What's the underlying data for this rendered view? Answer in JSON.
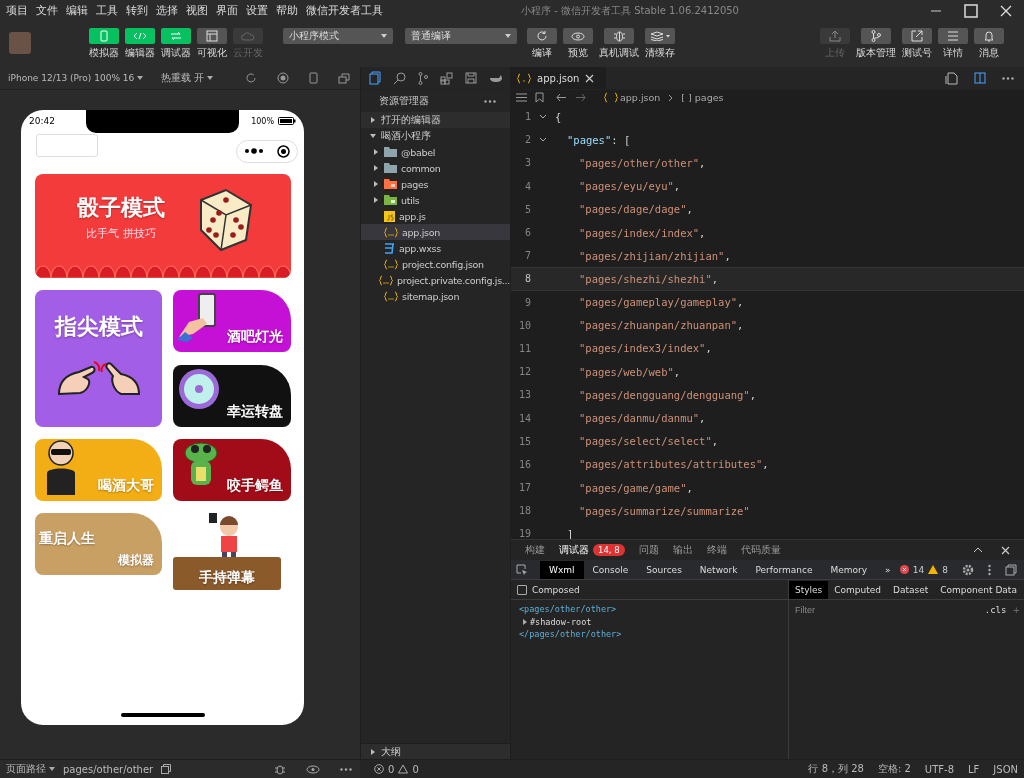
{
  "menu": [
    "项目",
    "文件",
    "编辑",
    "工具",
    "转到",
    "选择",
    "视图",
    "界面",
    "设置",
    "帮助",
    "微信开发者工具"
  ],
  "window": {
    "title": "小程序 - 微信开发者工具 Stable 1.06.2412050"
  },
  "view_toggles": [
    {
      "label": "模拟器",
      "selected": true,
      "disabled": false
    },
    {
      "label": "编辑器",
      "selected": true,
      "disabled": false
    },
    {
      "label": "调试器",
      "selected": true,
      "disabled": false
    },
    {
      "label": "可视化",
      "selected": false,
      "disabled": false
    },
    {
      "label": "云开发",
      "selected": false,
      "disabled": true
    }
  ],
  "mode_select": "小程序模式",
  "compile_select": "普通编译",
  "actions": [
    "编译",
    "预览",
    "真机调试",
    "清缓存"
  ],
  "right_actions": [
    {
      "label": "上传",
      "disabled": true
    },
    {
      "label": "版本管理",
      "disabled": false
    },
    {
      "label": "测试号",
      "disabled": false
    },
    {
      "label": "详情",
      "disabled": false
    },
    {
      "label": "消息",
      "disabled": false
    }
  ],
  "device_select": "iPhone 12/13 (Pro) 100% 16",
  "hot_reload": "热重载 开",
  "phone": {
    "time": "20:42",
    "battery": "100%",
    "cards": [
      {
        "kind": "banner",
        "title": "骰子模式",
        "subtitle": "比手气 拼技巧",
        "color": "#f43b3b"
      },
      {
        "kind": "tall",
        "title": "指尖模式",
        "color": "#a25ee6"
      },
      {
        "kind": "small",
        "title": "酒吧灯光",
        "color": "#c511d6"
      },
      {
        "kind": "small",
        "title": "幸运转盘",
        "color": "#111111"
      },
      {
        "kind": "small",
        "title": "喝酒大哥",
        "color": "#f2ae14"
      },
      {
        "kind": "small",
        "title": "咬手鳄鱼",
        "color": "#a10c18"
      },
      {
        "kind": "small",
        "title": "重启人生",
        "subtitle": "模拟器",
        "color": "#c9a064"
      },
      {
        "kind": "board",
        "title": "手持弹幕",
        "color": "#8a5a2b"
      }
    ]
  },
  "explorer": {
    "title": "资源管理器",
    "sections": [
      {
        "label": "打开的编辑器",
        "expanded": false
      },
      {
        "label": "喝酒小程序",
        "expanded": true,
        "children": [
          {
            "name": "@babel",
            "kind": "folder",
            "expanded": false,
            "selected": false
          },
          {
            "name": "common",
            "kind": "folder",
            "expanded": false,
            "selected": false
          },
          {
            "name": "pages",
            "kind": "pages",
            "expanded": false,
            "selected": false
          },
          {
            "name": "utils",
            "kind": "utils",
            "expanded": false,
            "selected": false
          },
          {
            "name": "app.js",
            "kind": "js",
            "selected": false
          },
          {
            "name": "app.json",
            "kind": "json",
            "selected": true
          },
          {
            "name": "app.wxss",
            "kind": "css",
            "selected": false
          },
          {
            "name": "project.config.json",
            "kind": "json",
            "selected": false
          },
          {
            "name": "project.private.config.js...",
            "kind": "json",
            "selected": false
          },
          {
            "name": "sitemap.json",
            "kind": "json",
            "selected": false
          }
        ]
      }
    ],
    "outline": {
      "label": "大纲",
      "expanded": false
    }
  },
  "editor": {
    "tab": "app.json",
    "breadcrumb": [
      "app.json",
      "[ ] pages"
    ],
    "lines": [
      {
        "number": "1",
        "kind": "open",
        "parts": [
          {
            "kind": "punct",
            "text": "{"
          }
        ]
      },
      {
        "number": "2",
        "kind": "key",
        "parts": [
          {
            "kind": "key",
            "text": "\"pages\""
          },
          {
            "kind": "punct",
            "text": ": ["
          }
        ]
      },
      {
        "number": "3",
        "kind": "item",
        "parts": [
          {
            "kind": "string",
            "text": "\"pages/other/other\""
          },
          {
            "kind": "punct",
            "text": ","
          }
        ]
      },
      {
        "number": "4",
        "kind": "item",
        "parts": [
          {
            "kind": "string",
            "text": "\"pages/eyu/eyu\""
          },
          {
            "kind": "punct",
            "text": ","
          }
        ]
      },
      {
        "number": "5",
        "kind": "item",
        "parts": [
          {
            "kind": "string",
            "text": "\"pages/dage/dage\""
          },
          {
            "kind": "punct",
            "text": ","
          }
        ]
      },
      {
        "number": "6",
        "kind": "item",
        "parts": [
          {
            "kind": "string",
            "text": "\"pages/index/index\""
          },
          {
            "kind": "punct",
            "text": ","
          }
        ]
      },
      {
        "number": "7",
        "kind": "item",
        "parts": [
          {
            "kind": "string",
            "text": "\"pages/zhijian/zhijian\""
          },
          {
            "kind": "punct",
            "text": ","
          }
        ]
      },
      {
        "number": "8",
        "kind": "item",
        "current": true,
        "parts": [
          {
            "kind": "string",
            "text": "\"pages/shezhi/shezhi\""
          },
          {
            "kind": "punct",
            "text": ","
          }
        ]
      },
      {
        "number": "9",
        "kind": "item",
        "parts": [
          {
            "kind": "string",
            "text": "\"pages/gameplay/gameplay\""
          },
          {
            "kind": "punct",
            "text": ","
          }
        ]
      },
      {
        "number": "10",
        "kind": "item",
        "parts": [
          {
            "kind": "string",
            "text": "\"pages/zhuanpan/zhuanpan\""
          },
          {
            "kind": "punct",
            "text": ","
          }
        ]
      },
      {
        "number": "11",
        "kind": "item",
        "parts": [
          {
            "kind": "string",
            "text": "\"pages/index3/index\""
          },
          {
            "kind": "punct",
            "text": ","
          }
        ]
      },
      {
        "number": "12",
        "kind": "item",
        "parts": [
          {
            "kind": "string",
            "text": "\"pages/web/web\""
          },
          {
            "kind": "punct",
            "text": ","
          }
        ]
      },
      {
        "number": "13",
        "kind": "item",
        "parts": [
          {
            "kind": "string",
            "text": "\"pages/dengguang/dengguang\""
          },
          {
            "kind": "punct",
            "text": ","
          }
        ]
      },
      {
        "number": "14",
        "kind": "item",
        "parts": [
          {
            "kind": "string",
            "text": "\"pages/danmu/danmu\""
          },
          {
            "kind": "punct",
            "text": ","
          }
        ]
      },
      {
        "number": "15",
        "kind": "item",
        "parts": [
          {
            "kind": "string",
            "text": "\"pages/select/select\""
          },
          {
            "kind": "punct",
            "text": ","
          }
        ]
      },
      {
        "number": "16",
        "kind": "item",
        "parts": [
          {
            "kind": "string",
            "text": "\"pages/attributes/attributes\""
          },
          {
            "kind": "punct",
            "text": ","
          }
        ]
      },
      {
        "number": "17",
        "kind": "item",
        "parts": [
          {
            "kind": "string",
            "text": "\"pages/game/game\""
          },
          {
            "kind": "punct",
            "text": ","
          }
        ]
      },
      {
        "number": "18",
        "kind": "item",
        "parts": [
          {
            "kind": "string",
            "text": "\"pages/summarize/summarize\""
          }
        ]
      },
      {
        "number": "19",
        "kind": "key",
        "parts": [
          {
            "kind": "punct",
            "text": "]"
          }
        ]
      }
    ]
  },
  "panel": {
    "tabs": [
      {
        "label": "构建",
        "selected": false
      },
      {
        "label": "调试器",
        "selected": true,
        "badge": "14, 8"
      },
      {
        "label": "问题",
        "selected": false
      },
      {
        "label": "输出",
        "selected": false
      },
      {
        "label": "终端",
        "selected": false
      },
      {
        "label": "代码质量",
        "selected": false
      }
    ],
    "devtools_tabs": [
      {
        "label": "Wxml",
        "selected": true
      },
      {
        "label": "Console",
        "selected": false
      },
      {
        "label": "Sources",
        "selected": false
      },
      {
        "label": "Network",
        "selected": false
      },
      {
        "label": "Performance",
        "selected": false
      },
      {
        "label": "Memory",
        "selected": false
      }
    ],
    "more": "»",
    "errors": "14",
    "warnings": "8",
    "composed": {
      "label": "Composed",
      "checked": false
    },
    "tree": [
      {
        "kind": "tag",
        "text": "<pages/other/other>"
      },
      {
        "kind": "node",
        "text": "#shadow-root"
      },
      {
        "kind": "tag",
        "text": "</pages/other/other>"
      }
    ],
    "style_tabs": [
      {
        "label": "Styles",
        "selected": true
      },
      {
        "label": "Computed",
        "selected": false
      },
      {
        "label": "Dataset",
        "selected": false
      },
      {
        "label": "Component Data",
        "selected": false
      }
    ],
    "filter_placeholder": "Filter",
    "cls": ".cls",
    "add": "+"
  },
  "status_bar": {
    "page_path_label": "页面路径",
    "page_path": "pages/other/other",
    "errors": "0",
    "warnings": "0",
    "items": [
      "行 8，列 28",
      "空格: 2",
      "UTF-8",
      "LF",
      "JSON"
    ]
  }
}
